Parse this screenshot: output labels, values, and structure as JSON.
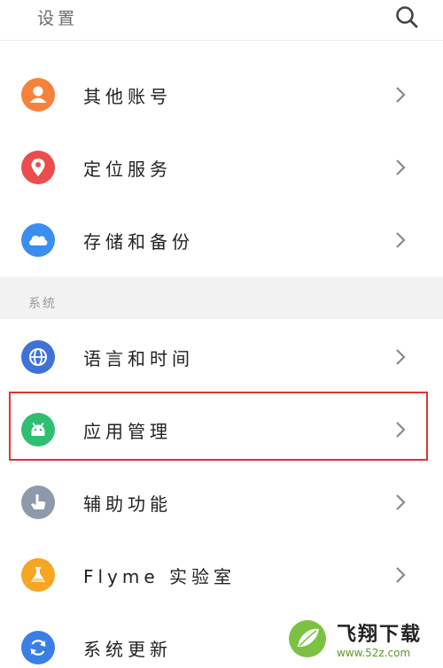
{
  "header": {
    "title": "设置",
    "search_icon": "search-icon"
  },
  "account_items": [
    {
      "label": "其他账号",
      "icon": "person-icon",
      "color": "#f4823c"
    },
    {
      "label": "定位服务",
      "icon": "location-pin-icon",
      "color": "#ea4d4d"
    },
    {
      "label": "存储和备份",
      "icon": "cloud-icon",
      "color": "#3a8ef0"
    }
  ],
  "section": {
    "label": "系统"
  },
  "system_items": [
    {
      "label": "语言和时间",
      "icon": "globe-icon",
      "color": "#3f72d8"
    },
    {
      "label": "应用管理",
      "icon": "android-icon",
      "color": "#2fbf71"
    },
    {
      "label": "辅助功能",
      "icon": "hand-icon",
      "color": "#8e9aac"
    },
    {
      "label": "Flyme 实验室",
      "icon": "flask-icon",
      "color": "#f5a623"
    },
    {
      "label": "系统更新",
      "icon": "refresh-icon",
      "color": "#3a7fe6"
    }
  ],
  "colors": {
    "highlight": "#e03434",
    "section_bg": "#f2f2f2",
    "chevron": "#8a8a8a"
  },
  "watermark": {
    "text": "飞翔下载",
    "url": "www.52z.com"
  }
}
